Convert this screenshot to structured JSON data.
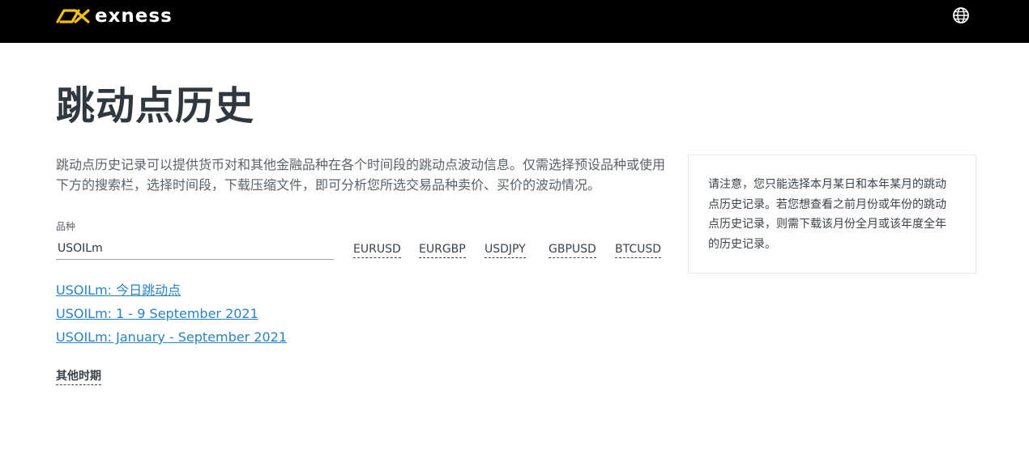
{
  "header": {
    "brand": "exness",
    "language_icon": "globe-icon",
    "background": "#000000",
    "logo_color": "#f4c10d"
  },
  "main": {
    "title": "跳动点历史",
    "intro": "跳动点历史记录可以提供货币对和其他金融品种在各个时间段的跳动点波动信息。仅需选择预设品种或使用下方的搜索栏，选择时间段，下载压缩文件，即可分析您所选交易品种卖价、买价的波动情况。",
    "symbol_field": {
      "label": "品种",
      "value": "USOILm"
    },
    "presets": [
      "EURUSD",
      "EURGBP",
      "USDJPY",
      "GBPUSD",
      "BTCUSD"
    ],
    "history_links": [
      "USOILm: 今日跳动点",
      "USOILm: 1 - 9 September 2021",
      "USOILm: January - September 2021"
    ],
    "other_periods_label": "其他时期",
    "link_color": "#2a83c1"
  },
  "notice": {
    "text": "请注意，您只能选择本月某日和本年某月的跳动点历史记录。若您想查看之前月份或年份的跳动点历史记录，则需下载该月份全月或该年度全年的历史记录。"
  }
}
